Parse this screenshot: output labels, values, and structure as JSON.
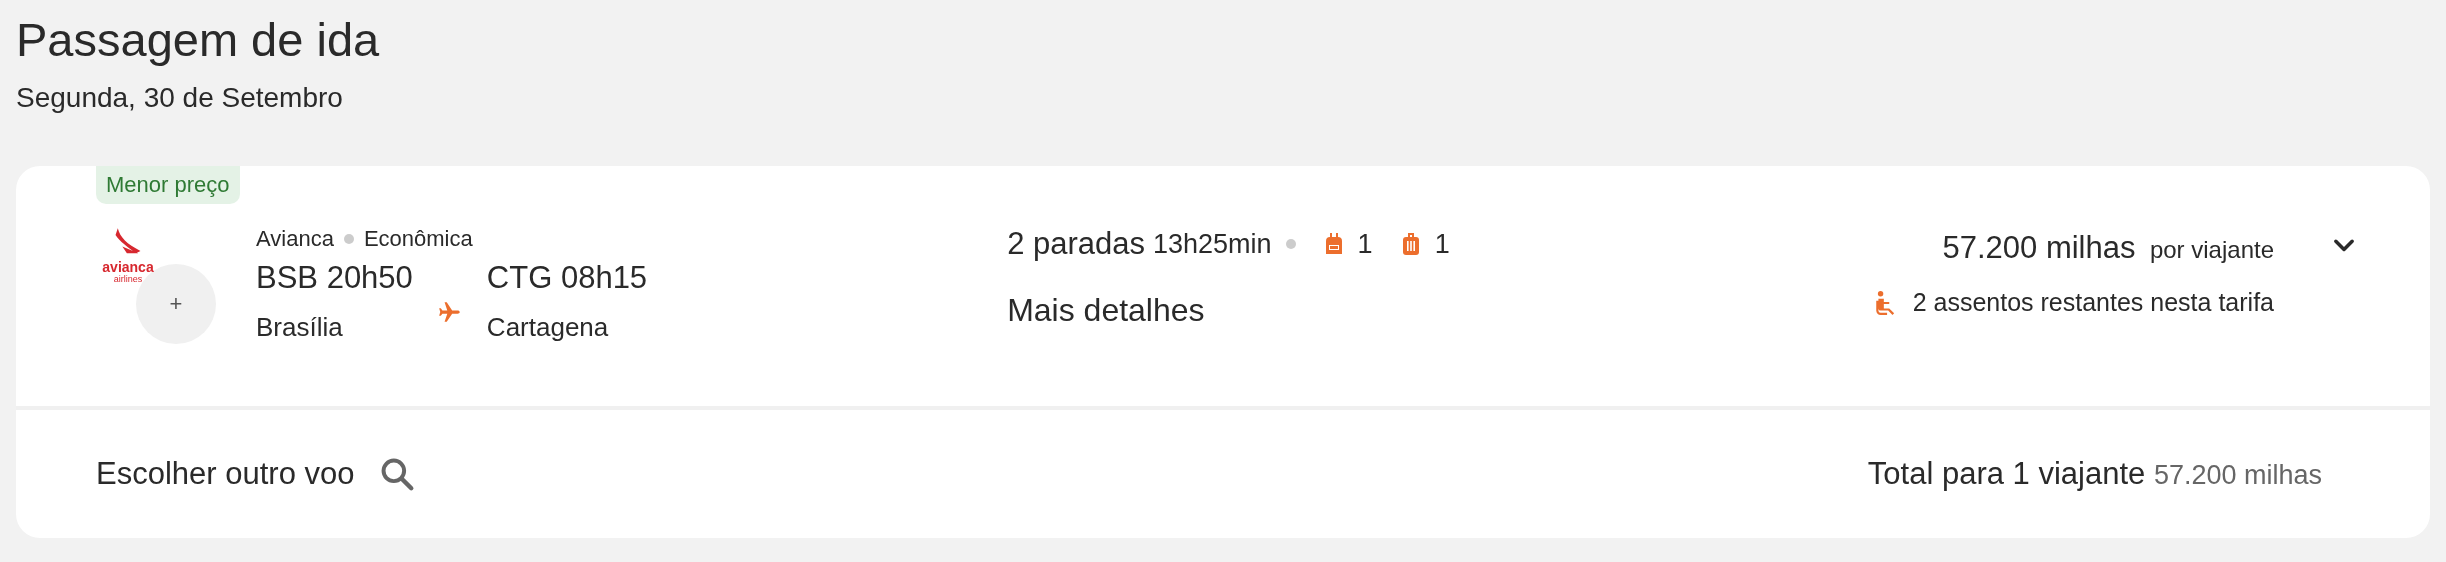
{
  "header": {
    "title": "Passagem de ida",
    "date": "Segunda, 30 de Setembro"
  },
  "flight": {
    "badge": "Menor preço",
    "logo": {
      "name": "avianca",
      "tagline": "airlines"
    },
    "extra_airline_mark": "+",
    "airline": "Avianca",
    "cabin": "Econômica",
    "departure": {
      "code_time": "BSB 20h50",
      "city": "Brasília"
    },
    "arrival": {
      "code_time": "CTG 08h15",
      "city": "Cartagena"
    },
    "stops": "2 paradas",
    "duration": "13h25min",
    "bags": [
      {
        "kind": "backpack",
        "count": "1"
      },
      {
        "kind": "suitcase",
        "count": "1"
      }
    ],
    "details_link": "Mais detalhes",
    "price": "57.200 milhas",
    "price_note": "por viajante",
    "seats_left": "2 assentos restantes nesta tarifa",
    "expanded": false
  },
  "footer": {
    "other_flight": "Escolher outro voo",
    "total_label": "Total para 1 viajante",
    "total_value": "57.200 milhas"
  }
}
